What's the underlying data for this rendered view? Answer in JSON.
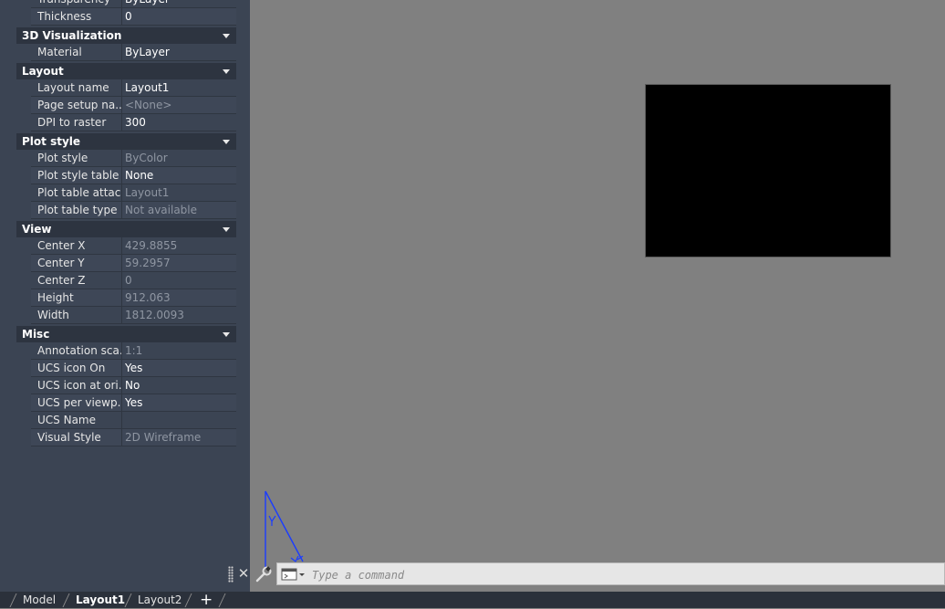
{
  "properties": {
    "top_rows": [
      {
        "name": "Transparency",
        "value": "ByLayer",
        "readonly": false
      },
      {
        "name": "Thickness",
        "value": "0",
        "readonly": false
      }
    ],
    "sections": [
      {
        "title": "3D Visualization",
        "rows": [
          {
            "name": "Material",
            "value": "ByLayer",
            "readonly": false
          }
        ]
      },
      {
        "title": "Layout",
        "rows": [
          {
            "name": "Layout name",
            "value": "Layout1",
            "readonly": false
          },
          {
            "name": "Page setup na...",
            "value": "<None>",
            "readonly": true
          },
          {
            "name": "DPI to raster",
            "value": "300",
            "readonly": false
          }
        ]
      },
      {
        "title": "Plot style",
        "rows": [
          {
            "name": "Plot style",
            "value": "ByColor",
            "readonly": true
          },
          {
            "name": "Plot style table",
            "value": "None",
            "readonly": false
          },
          {
            "name": "Plot table attac...",
            "value": "Layout1",
            "readonly": true
          },
          {
            "name": "Plot table type",
            "value": "Not available",
            "readonly": true
          }
        ]
      },
      {
        "title": "View",
        "rows": [
          {
            "name": "Center X",
            "value": "429.8855",
            "readonly": true
          },
          {
            "name": "Center Y",
            "value": "59.2957",
            "readonly": true
          },
          {
            "name": "Center Z",
            "value": "0",
            "readonly": true
          },
          {
            "name": "Height",
            "value": "912.063",
            "readonly": true
          },
          {
            "name": "Width",
            "value": "1812.0093",
            "readonly": true
          }
        ]
      },
      {
        "title": "Misc",
        "rows": [
          {
            "name": "Annotation sca...",
            "value": "1:1",
            "readonly": true
          },
          {
            "name": "UCS icon On",
            "value": "Yes",
            "readonly": false
          },
          {
            "name": "UCS icon at ori...",
            "value": "No",
            "readonly": false
          },
          {
            "name": "UCS per viewp...",
            "value": "Yes",
            "readonly": false
          },
          {
            "name": "UCS Name",
            "value": "",
            "readonly": false
          },
          {
            "name": "Visual Style",
            "value": "2D Wireframe",
            "readonly": true
          }
        ]
      }
    ]
  },
  "command_line": {
    "placeholder": "Type a command",
    "close_icon": "close-icon",
    "customize_icon": "wrench-icon",
    "recent_icon": "command-prompt-icon"
  },
  "layout_tabs": {
    "tabs": [
      {
        "label": "Model",
        "active": false
      },
      {
        "label": "Layout1",
        "active": true
      },
      {
        "label": "Layout2",
        "active": false
      }
    ],
    "add_label": "+"
  },
  "colors": {
    "palette_bg": "#3b4453",
    "drawing_bg": "#808080",
    "viewport_bg": "#000000",
    "ucs_icon": "#1a3cff"
  }
}
